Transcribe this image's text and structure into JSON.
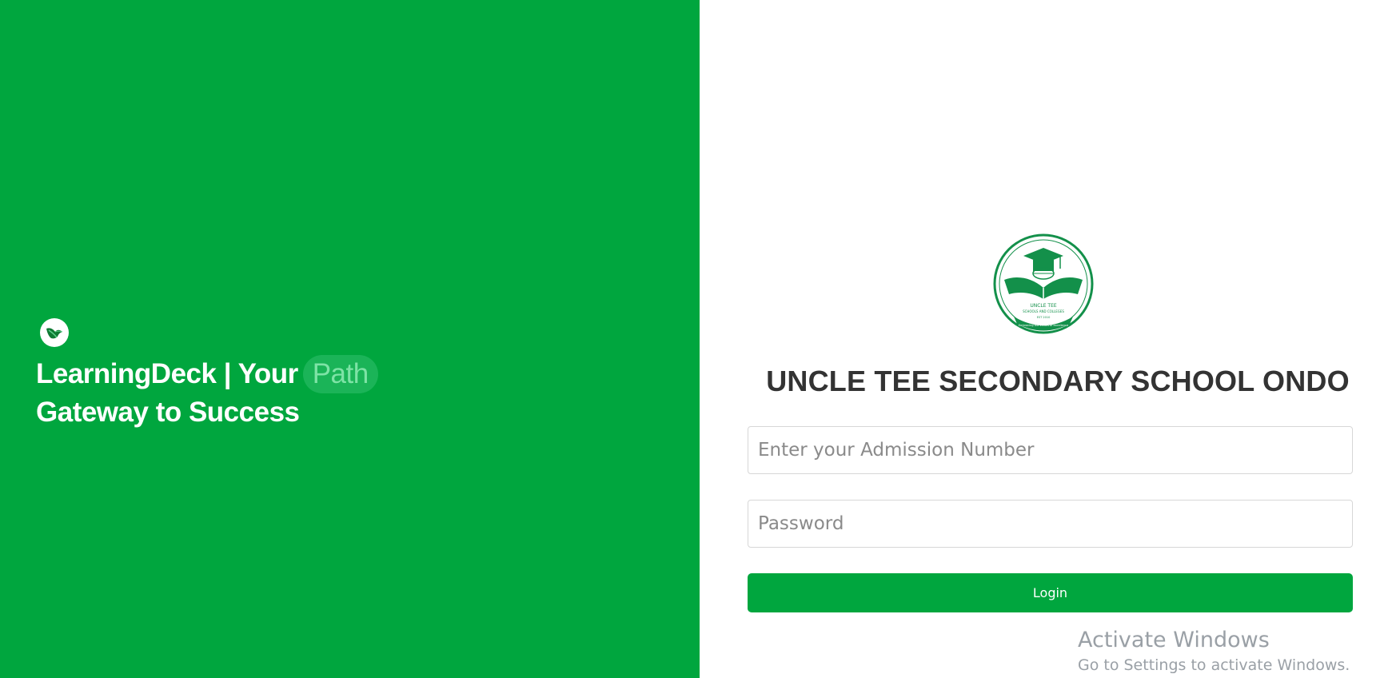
{
  "brand": {
    "logo_icon": "leaf-logo-icon",
    "tagline_part1": "LearningDeck | Your",
    "tagline_highlight": "Path",
    "tagline_part2": "Gateway to Success"
  },
  "school": {
    "crest_icon": "school-crest-logo",
    "crest_text_top": "UNCLE TEE",
    "crest_text_mid": "SCHOOLS AND COLLEGES",
    "crest_text_est": "EST 2010",
    "crest_text_motto": "Embracing the values of excellence",
    "name": "UNCLE TEE SECONDARY SCHOOL ONDO"
  },
  "form": {
    "admission_placeholder": "Enter your Admission Number",
    "admission_value": "",
    "password_placeholder": "Password",
    "password_value": "",
    "login_label": "Login"
  },
  "watermark": {
    "title": "Activate Windows",
    "subtitle": "Go to Settings to activate Windows."
  },
  "colors": {
    "brand_green": "#00a63e",
    "highlight_text": "#7ee3a6",
    "heading_text": "#333333"
  }
}
